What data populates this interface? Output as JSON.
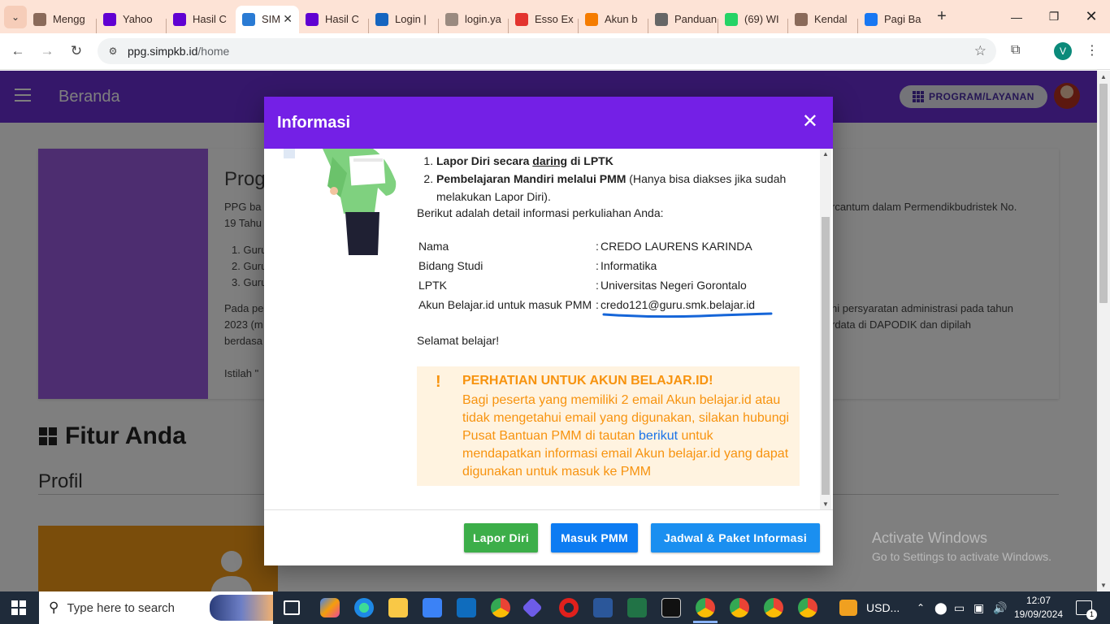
{
  "browser": {
    "tabs": [
      {
        "title": "Mengg",
        "favicon": "#8a6a5a"
      },
      {
        "title": "Yahoo",
        "favicon": "#6001d2"
      },
      {
        "title": "Hasil C",
        "favicon": "#6001d2"
      },
      {
        "title": "SIM",
        "favicon": "#2a7bd4",
        "active": true
      },
      {
        "title": "Hasil C",
        "favicon": "#6001d2"
      },
      {
        "title": "Login |",
        "favicon": "#1565c0"
      },
      {
        "title": "login.ya",
        "favicon": "#9a8a80"
      },
      {
        "title": "Esso Ex",
        "favicon": "#e3342f"
      },
      {
        "title": "Akun b",
        "favicon": "#f57c00"
      },
      {
        "title": "Panduan",
        "favicon": "#666666"
      },
      {
        "title": "(69) WI",
        "favicon": "#25d366"
      },
      {
        "title": "Kendal",
        "favicon": "#8a6a5a"
      },
      {
        "title": "Pagi Ba",
        "favicon": "#1877f2"
      }
    ],
    "url_domain": "ppg.simpkb.id",
    "url_path": "/home",
    "profile_initial": "V"
  },
  "app": {
    "title": "Beranda",
    "program_button": "PROGRAM/LAYANAN"
  },
  "background": {
    "card_title": "Prog",
    "card_p1_left": "PPG ba",
    "card_p1_right": "rcantum dalam Permendikbudristek No.",
    "card_p1_line2": "19 Tahu",
    "card_list": [
      "Guru",
      "Guru",
      "Guru"
    ],
    "card_p2_left": "Pada pe",
    "card_p2_right": "hi persyaratan administrasi pada tahun",
    "card_p2_line2_left": "2023 (m",
    "card_p2_line2_right": "rdata di DAPODIK dan dipilah",
    "card_p2_line3": "berdasa",
    "card_p3": "Istilah \"",
    "fitur_title": "Fitur Anda",
    "profil_title": "Profil",
    "watermark_line1": "Activate Windows",
    "watermark_line2": "Go to Settings to activate Windows."
  },
  "modal": {
    "title": "Informasi",
    "close_label": "✕",
    "step1_bold_a": "Lapor Diri secara ",
    "step1_underline": "daring",
    "step1_bold_b": " di LPTK",
    "step2_bold": "Pembelajaran Mandiri melalui PMM",
    "step2_rest": " (Hanya bisa diakses jika sudah melakukan Lapor Diri).",
    "detail_intro": "Berikut adalah detail informasi perkuliahan Anda:",
    "details": [
      {
        "label": "Nama",
        "value": "CREDO LAURENS KARINDA"
      },
      {
        "label": "Bidang Studi",
        "value": "Informatika"
      },
      {
        "label": "LPTK",
        "value": "Universitas Negeri Gorontalo"
      },
      {
        "label": "Akun Belajar.id untuk masuk PMM",
        "value": "credo121@guru.smk.belajar.id"
      }
    ],
    "separator": ":",
    "closing": "Selamat belajar!",
    "alert_icon": "!",
    "alert_title": "PERHATIAN UNTUK AKUN BELAJAR.ID!",
    "alert_text_a": "Bagi peserta yang memiliki 2 email Akun belajar.id atau tidak mengetahui email yang digunakan, silakan hubungi Pusat Bantuan PMM di tautan ",
    "alert_link": "berikut",
    "alert_text_b": " untuk mendapatkan informasi email Akun belajar.id yang dapat digunakan untuk masuk ke PMM",
    "buttons": {
      "lapor": "Lapor Diri",
      "masuk": "Masuk PMM",
      "jadwal": "Jadwal & Paket Informasi"
    }
  },
  "taskbar": {
    "search_placeholder": "Type here to search",
    "currency": "USD...",
    "time": "12:07",
    "date": "19/09/2024",
    "notif_count": "1"
  }
}
